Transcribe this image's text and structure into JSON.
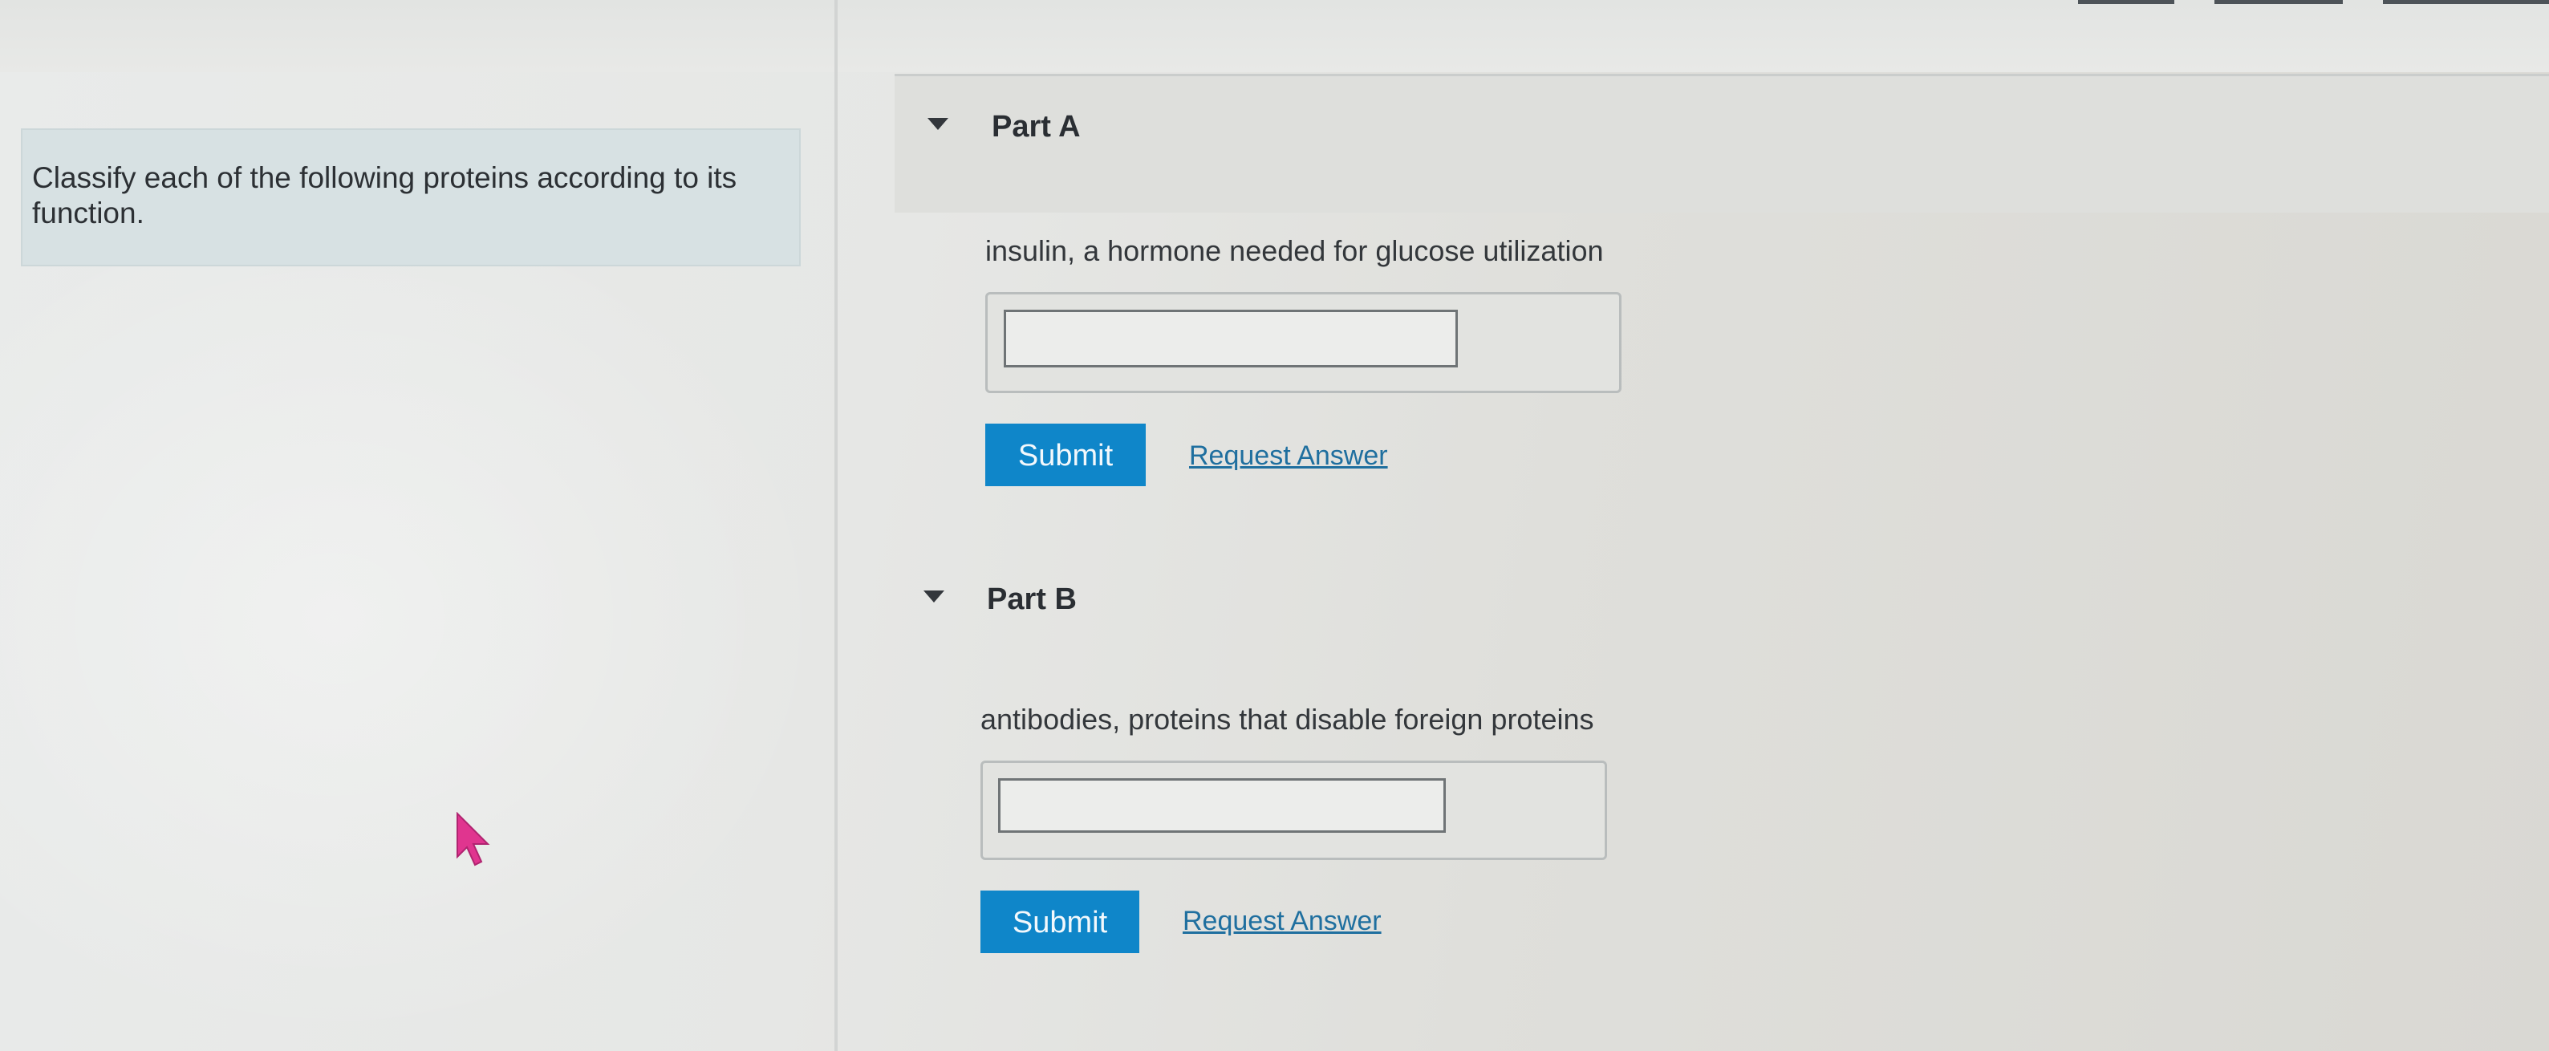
{
  "instruction": "Classify each of the following proteins according to its function.",
  "parts": [
    {
      "label": "Part A",
      "question": "insulin, a hormone needed for glucose utilization",
      "answer_value": "",
      "submit_label": "Submit",
      "request_label": "Request Answer"
    },
    {
      "label": "Part B",
      "question": "antibodies, proteins that disable foreign proteins",
      "answer_value": "",
      "submit_label": "Submit",
      "request_label": "Request Answer"
    }
  ],
  "icons": {
    "collapse": "caret-down-icon",
    "pointer": "mouse-cursor-icon"
  },
  "colors": {
    "submit_button": "#0f86c9",
    "link": "#1f6f9f",
    "instruction_panel": "#d7e1e3",
    "cursor": "#e0358f"
  }
}
